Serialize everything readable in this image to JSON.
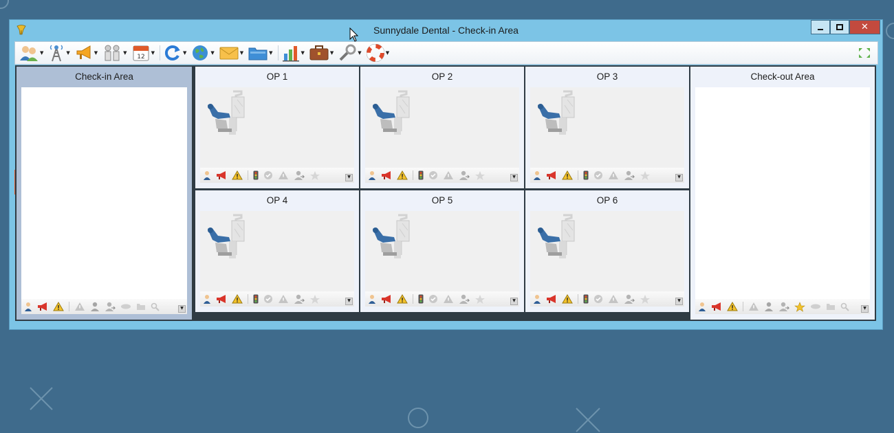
{
  "window": {
    "title": "Sunnydale Dental - Check-in Area",
    "controls": {
      "minimize": "▁",
      "maximize": "□",
      "close": "✕"
    }
  },
  "toolbar": {
    "items": [
      {
        "name": "patients-icon",
        "has_dropdown": true
      },
      {
        "name": "broadcast-tower-icon",
        "has_dropdown": true
      },
      {
        "name": "megaphone-icon",
        "has_dropdown": true
      },
      {
        "name": "people-icon",
        "has_dropdown": true
      },
      {
        "name": "calendar-icon",
        "label": "12",
        "has_dropdown": true
      },
      {
        "name": "refresh-icon",
        "has_dropdown": true
      },
      {
        "name": "globe-icon",
        "has_dropdown": true
      },
      {
        "name": "envelope-icon",
        "has_dropdown": true
      },
      {
        "name": "folder-icon",
        "has_dropdown": true
      },
      {
        "name": "bar-chart-icon",
        "has_dropdown": true
      },
      {
        "name": "briefcase-icon",
        "has_dropdown": true
      },
      {
        "name": "wrench-icon",
        "has_dropdown": true
      },
      {
        "name": "lifebuoy-icon",
        "has_dropdown": true
      }
    ],
    "expand_icon": "expand-icon"
  },
  "panes": {
    "checkin": {
      "title": "Check-in Area"
    },
    "checkout": {
      "title": "Check-out Area"
    },
    "ops": [
      {
        "title": "OP 1"
      },
      {
        "title": "OP 2"
      },
      {
        "title": "OP 3"
      },
      {
        "title": "OP 4"
      },
      {
        "title": "OP 5"
      },
      {
        "title": "OP 6"
      }
    ]
  },
  "status_icons": {
    "op": [
      "patient-icon",
      "megaphone-icon",
      "warning-icon",
      "traffic-light-icon",
      "check-icon",
      "alert-gray-icon",
      "user-transfer-icon",
      "star-icon"
    ],
    "checkin": [
      "patient-icon",
      "megaphone-icon",
      "warning-icon",
      "alert-gray-icon",
      "user-gray-icon",
      "user-transfer-icon",
      "card-icon",
      "folder-icon",
      "search-icon"
    ],
    "checkout": [
      "patient-icon",
      "megaphone-icon",
      "warning-icon",
      "alert-gray-icon",
      "user-gray-icon",
      "user-transfer-icon",
      "star-icon",
      "card-icon",
      "folder-icon",
      "search-icon"
    ]
  },
  "colors": {
    "desktop": "#3f6b8c",
    "window_frame": "#7cc4e6",
    "close_button": "#c24a3e",
    "checkin_header": "#aebfd6",
    "pane_header": "#eef2fa"
  }
}
